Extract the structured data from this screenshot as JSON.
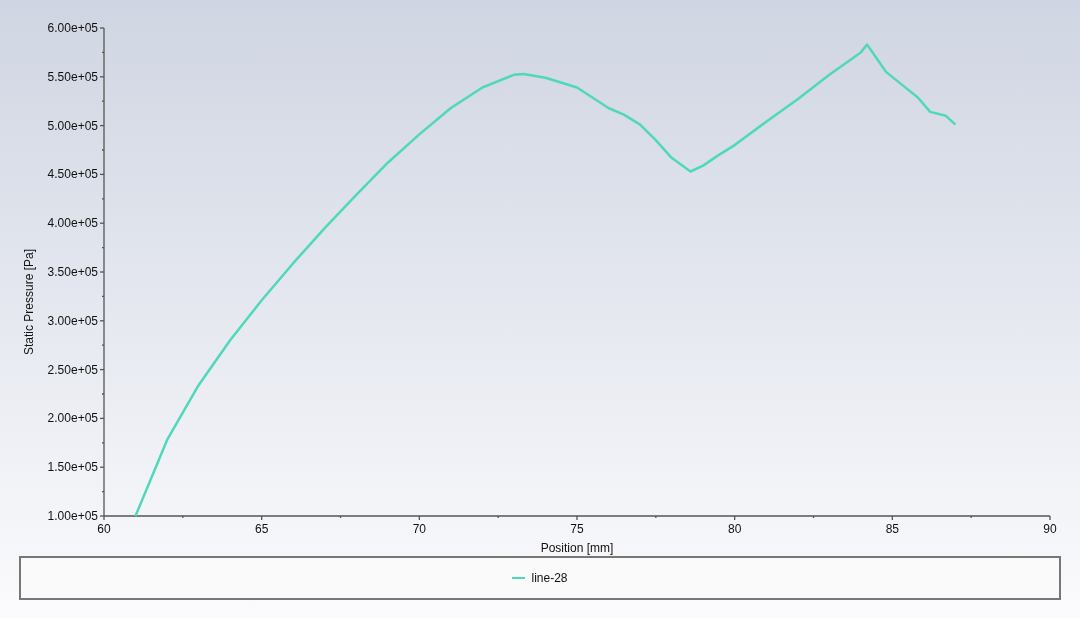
{
  "chart_data": {
    "type": "line",
    "xlabel": "Position [mm]",
    "ylabel": "Static Pressure [Pa]",
    "xlim": [
      60,
      90
    ],
    "ylim": [
      100000,
      600000
    ],
    "xticks": [
      60,
      65,
      70,
      75,
      80,
      85,
      90
    ],
    "yticks": [
      {
        "value": 100000,
        "label": "1.00e+05"
      },
      {
        "value": 150000,
        "label": "1.50e+05"
      },
      {
        "value": 200000,
        "label": "2.00e+05"
      },
      {
        "value": 250000,
        "label": "2.50e+05"
      },
      {
        "value": 300000,
        "label": "3.00e+05"
      },
      {
        "value": 350000,
        "label": "3.50e+05"
      },
      {
        "value": 400000,
        "label": "4.00e+05"
      },
      {
        "value": 450000,
        "label": "4.50e+05"
      },
      {
        "value": 500000,
        "label": "5.00e+05"
      },
      {
        "value": 550000,
        "label": "5.50e+05"
      },
      {
        "value": 600000,
        "label": "6.00e+05"
      }
    ],
    "x": [
      61,
      62,
      63,
      64,
      65,
      66,
      67,
      68,
      69,
      70,
      71,
      72,
      73,
      73.3,
      74,
      75,
      76,
      76.5,
      77,
      77.5,
      78,
      78.6,
      79,
      79.5,
      80,
      81,
      82,
      83,
      84,
      84.2,
      84.5,
      84.8,
      85.3,
      85.8,
      86.2,
      86.7,
      87
    ],
    "series": [
      {
        "name": "line-28",
        "color": "#4fd8bb",
        "values": [
          100000,
          178000,
          234000,
          280000,
          321000,
          359000,
          395000,
          429000,
          462000,
          491000,
          518000,
          539000,
          552000,
          553000,
          549000,
          539000,
          518000,
          511000,
          501000,
          485000,
          467000,
          453000,
          459000,
          470000,
          480000,
          504000,
          527000,
          552000,
          575000,
          583000,
          569000,
          555000,
          542000,
          529000,
          514000,
          510000,
          501000
        ]
      }
    ]
  }
}
